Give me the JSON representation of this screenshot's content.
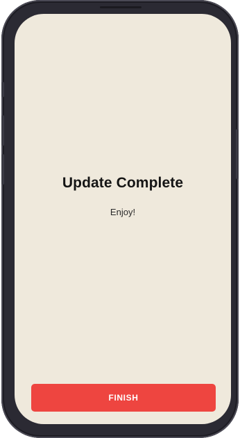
{
  "screen": {
    "title": "Update Complete",
    "subtitle": "Enjoy!",
    "primary_button_label": "FINISH"
  },
  "colors": {
    "background": "#efe9dc",
    "accent": "#ee4540",
    "text": "#151515",
    "device_frame": "#2b2a33"
  }
}
